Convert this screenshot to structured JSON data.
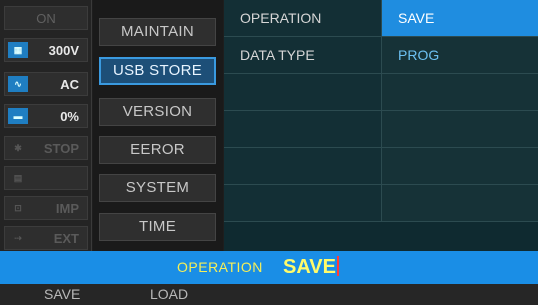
{
  "status": {
    "on_label": "ON",
    "voltage": "300V",
    "mode": "AC",
    "percent": "0%",
    "stop_label": "STOP",
    "imp_label": "IMP",
    "ext_label": "EXT",
    "voltage_icon": "voltage-range-icon",
    "wave_icon": "wave-icon",
    "battery_icon": "battery-icon"
  },
  "menu": {
    "items": [
      "MAINTAIN",
      "USB STORE",
      "VERSION",
      "EEROR",
      "SYSTEM",
      "TIME"
    ],
    "active_index": 1
  },
  "table": {
    "rows": [
      {
        "key": "OPERATION",
        "value": "SAVE",
        "selected": true
      },
      {
        "key": "DATA TYPE",
        "value": "PROG",
        "selected": false
      },
      {
        "key": "",
        "value": ""
      },
      {
        "key": "",
        "value": ""
      },
      {
        "key": "",
        "value": ""
      },
      {
        "key": "",
        "value": ""
      }
    ]
  },
  "edit": {
    "label": "OPERATION",
    "value": "SAVE"
  },
  "softkeys": [
    "SAVE",
    "LOAD"
  ],
  "colors": {
    "accent": "#1a8ee6",
    "edit_text": "#f5ef58",
    "value_text": "#6cc0f2"
  }
}
